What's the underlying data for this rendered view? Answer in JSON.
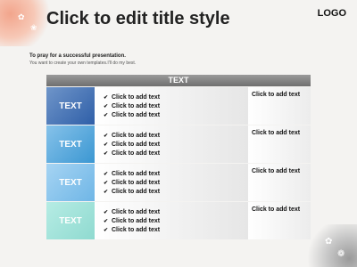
{
  "slide": {
    "title": "Click to edit title style",
    "logo": "LOGO",
    "subtitle": "To pray  for  a  successful presentation.",
    "subtext": "You want to create your own templates.I'll do my best."
  },
  "table": {
    "header": "TEXT",
    "rows": [
      {
        "label": "TEXT",
        "items": [
          "Click to add text",
          "Click to add text",
          "Click to add text"
        ],
        "side": "Click to add text"
      },
      {
        "label": "TEXT",
        "items": [
          "Click to add text",
          "Click to add text",
          "Click to add text"
        ],
        "side": "Click to add text"
      },
      {
        "label": "TEXT",
        "items": [
          "Click to add text",
          "Click to add text",
          "Click to add text"
        ],
        "side": "Click to add text"
      },
      {
        "label": "TEXT",
        "items": [
          "Click to add text",
          "Click to add text",
          "Click to add text"
        ],
        "side": "Click to add text"
      }
    ]
  },
  "icons": {
    "check": "check-icon",
    "corner_tl": "flower-decoration",
    "corner_br": "flower-decoration"
  },
  "colors": {
    "header": "#7f7f7f",
    "row1": "#2f5fa8",
    "row2": "#3b97d2",
    "row3": "#6fb6e6",
    "row4": "#8fdad0"
  }
}
